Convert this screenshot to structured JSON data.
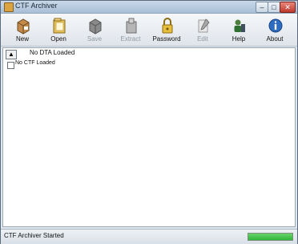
{
  "window": {
    "title": "CTF Archiver",
    "controls": {
      "minimize": "–",
      "maximize": "□",
      "close": "✕"
    }
  },
  "toolbar": {
    "buttons": [
      {
        "label": "New",
        "icon": "new-box-icon",
        "enabled": true
      },
      {
        "label": "Open",
        "icon": "folder-icon",
        "enabled": true
      },
      {
        "label": "Save",
        "icon": "save-box-icon",
        "enabled": false
      },
      {
        "label": "Extract",
        "icon": "extract-icon",
        "enabled": false
      },
      {
        "label": "Password",
        "icon": "padlock-icon",
        "enabled": true
      },
      {
        "label": "Edit",
        "icon": "pencil-icon",
        "enabled": false
      },
      {
        "label": "Help",
        "icon": "help-user-icon",
        "enabled": true
      },
      {
        "label": "About",
        "icon": "info-icon",
        "enabled": true
      }
    ]
  },
  "list": {
    "header_label": "No DTA Loaded",
    "up_arrow_icon": "up-arrow-icon",
    "items": [
      {
        "label": "No CTF Loaded",
        "checked": false
      }
    ]
  },
  "statusbar": {
    "text": "CTF Archiver Started",
    "progress_fraction": 1.0,
    "accent_color": "#2eb638"
  }
}
